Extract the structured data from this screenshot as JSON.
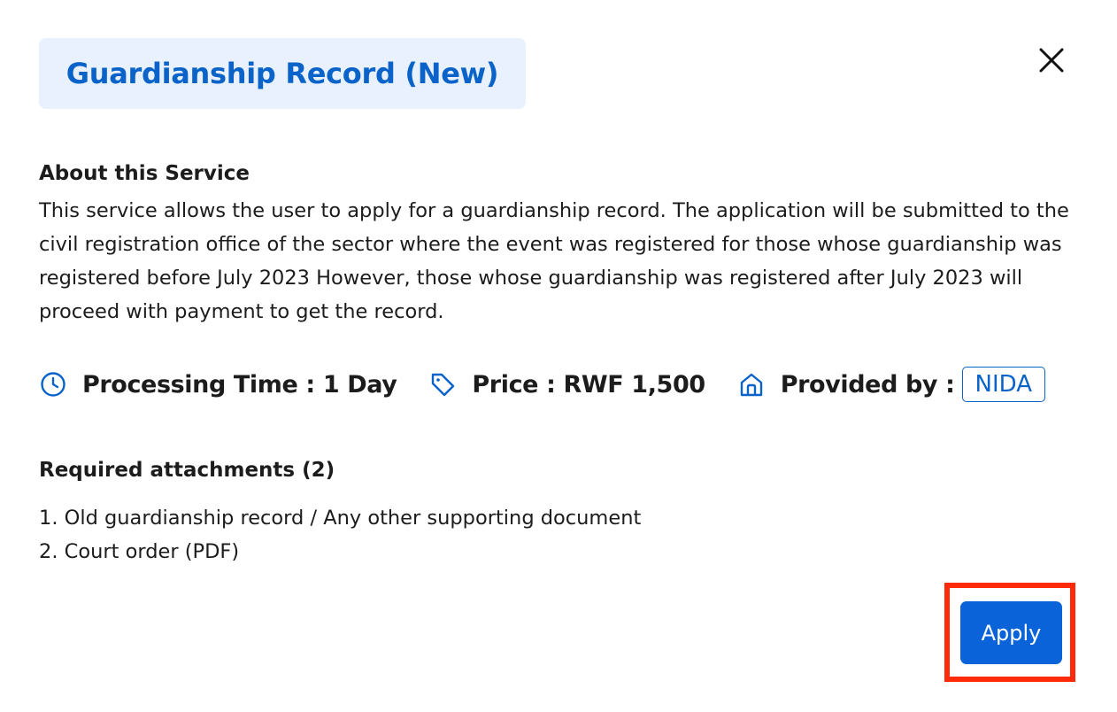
{
  "header": {
    "title": "Guardianship Record (New)",
    "close_icon": "close-icon"
  },
  "about": {
    "heading": "About this Service",
    "body": "This service allows the user to apply for a guardianship record. The application will be submitted to the civil registration office of the sector where the event was registered for those whose guardianship was registered before July 2023 However, those whose guardianship was registered after July 2023 will proceed with payment to get the record."
  },
  "meta": {
    "processing_time": "Processing Time : 1 Day",
    "price": "Price : RWF 1,500",
    "provided_by": "Provided by :",
    "provider": "NIDA",
    "icons": [
      "clock-icon",
      "tag-icon",
      "home-icon"
    ]
  },
  "attachments": {
    "heading": "Required attachments (2)",
    "items": [
      "1. Old guardianship record / Any other supporting document",
      "2. Court order (PDF)"
    ]
  },
  "actions": {
    "apply_label": "Apply"
  },
  "colors": {
    "accent": "#0a63c9",
    "title_bg": "#e8f1fd",
    "button": "#0a63d9",
    "highlight": "#ff2a0a"
  }
}
